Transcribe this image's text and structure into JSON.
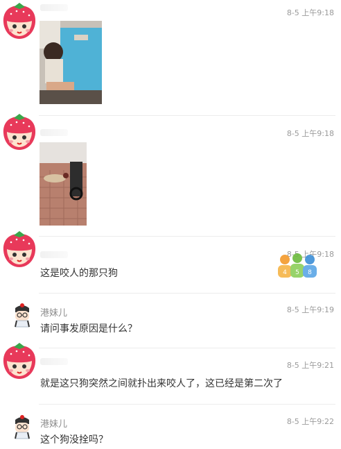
{
  "messages": [
    {
      "kind": "image",
      "time": "8-5 上午9:18",
      "avatar": "strawberry-avatar",
      "image": "child-injury-photo"
    },
    {
      "kind": "image",
      "time": "8-5 上午9:18",
      "avatar": "strawberry-avatar",
      "image": "dog-on-sidewalk-photo"
    },
    {
      "kind": "text",
      "time": "8-5 上午9:18",
      "avatar": "strawberry-avatar",
      "text": "这是咬人的那只狗"
    },
    {
      "kind": "text",
      "name": "港妹儿",
      "time": "8-5 上午9:19",
      "avatar": "reporter-avatar",
      "text": "请问事发原因是什么？"
    },
    {
      "kind": "text",
      "time": "8-5 上午9:21",
      "avatar": "strawberry-avatar",
      "text": "就是这只狗突然之间就扑出来咬人了，这已经是第二次了"
    },
    {
      "kind": "text",
      "name": "港妹儿",
      "time": "8-5 上午9:22",
      "avatar": "reporter-avatar",
      "text": "这个狗没拴吗？"
    }
  ],
  "watermark": {
    "icon": "people-logo-watermark",
    "digits": [
      "4",
      "5",
      "8"
    ]
  }
}
